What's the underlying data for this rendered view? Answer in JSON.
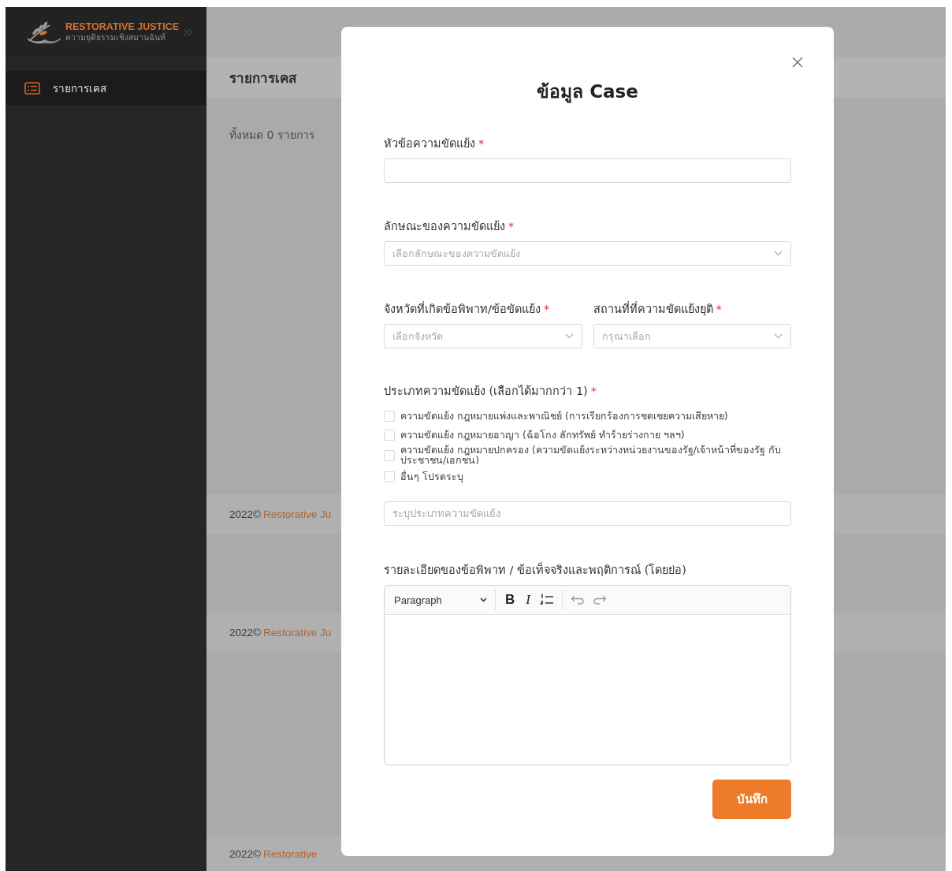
{
  "sidebar": {
    "logo": {
      "title": "RESTORATIVE JUSTICE",
      "subtitle": "ความยุติธรรมเชิงสมานฉันท์"
    },
    "items": [
      {
        "label": "รายการเคส",
        "selected": true
      }
    ]
  },
  "main": {
    "title": "รายการเคส",
    "count": "ทั้งหมด 0 รายการ",
    "footers": [
      {
        "year": "2022©",
        "brand": "Restorative Ju"
      },
      {
        "year": "2022©",
        "brand": "Restorative Ju"
      },
      {
        "year": "2022©",
        "brand": "Restorative"
      }
    ]
  },
  "modal": {
    "title": "ข้อมูล Case",
    "case_title": {
      "label": "หัวข้อความขัดแย้ง",
      "mark": "*"
    },
    "nature": {
      "label": "ลักษณะของความขัดแย้ง",
      "mark": "*",
      "placeholder": "เลือกลักษณะของความขัดแย้ง"
    },
    "province": {
      "label": "จังหวัดที่เกิดข้อพิพาท/ข้อขัดแย้ง",
      "mark": "*",
      "placeholder": "เลือกจังหวัด"
    },
    "venue": {
      "label": "สถานที่ที่ความขัดแย้งยุติ",
      "mark": "*",
      "placeholder": "กรุณาเลือก"
    },
    "types": {
      "label": "ประเภทความขัดแย้ง (เลือกได้มากกว่า 1)",
      "mark": "*",
      "options": [
        {
          "label": "ความขัดแย้ง กฎหมายแพ่งและพาณิชย์ (การเรียกร้องการชดเชยความเสียหาย)",
          "checked": false
        },
        {
          "label": "ความขัดแย้ง กฎหมายอาญา (ฉ้อโกง ลักทรัพย์ ทำร้ายร่างกาย ฯลฯ)",
          "checked": false
        },
        {
          "label": "ความขัดแย้ง กฎหมายปกครอง (ความขัดแย้งระหว่างหน่วยงานของรัฐ/เจ้าหน้าที่ของรัฐ กับประชาชน/เอกชน)",
          "checked": false
        },
        {
          "label": "อื่นๆ โปรดระบุ",
          "checked": false
        }
      ]
    },
    "other_type": {
      "placeholder": "ระบุประเภทความขัดแย้ง"
    },
    "details": {
      "label": "รายละเอียดของข้อพิพาท / ข้อเท็จจริงและพฤติการณ์ (โดยย่อ)",
      "format": "Paragraph",
      "tools": [
        {
          "kind": "bold",
          "glyph": "B"
        },
        {
          "kind": "italic",
          "glyph": "I"
        },
        {
          "kind": "list"
        },
        {
          "kind": "undo"
        },
        {
          "kind": "redo"
        }
      ]
    },
    "save_button": "บันทึก"
  }
}
